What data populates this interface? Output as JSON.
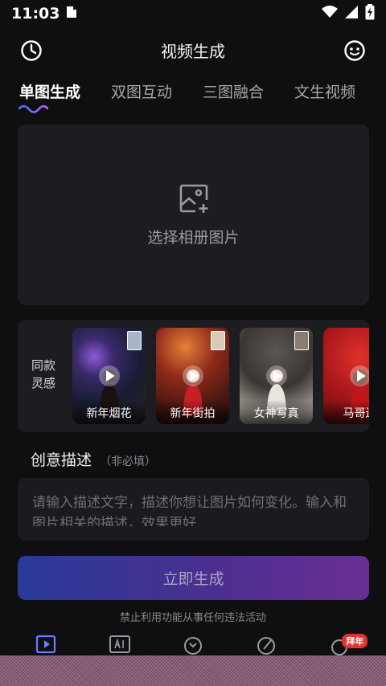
{
  "status_bar": {
    "time": "11:03"
  },
  "header": {
    "title": "视频生成",
    "history_icon": "clock-icon",
    "feedback_icon": "smiley-icon"
  },
  "tabs": [
    {
      "label": "单图生成",
      "active": true
    },
    {
      "label": "双图互动",
      "active": false
    },
    {
      "label": "三图融合",
      "active": false
    },
    {
      "label": "文生视频",
      "active": false
    }
  ],
  "upload": {
    "label": "选择相册图片",
    "icon": "image-add-icon"
  },
  "inspiration": {
    "label": "同款\n灵感",
    "items": [
      {
        "caption": "新年烟花"
      },
      {
        "caption": "新年街拍"
      },
      {
        "caption": "女神写真"
      },
      {
        "caption": "马哥送"
      }
    ]
  },
  "description": {
    "title": "创意描述",
    "subtitle": "（非必填）",
    "placeholder": "请输入描述文字，描述你想让图片如何变化。输入和图片相关的描述，效果更好"
  },
  "generate_button": {
    "label": "立即生成"
  },
  "disclaimer": "禁止利用功能从事任何违法活动",
  "bottom_nav": {
    "items": [
      {
        "icon": "video-ai-icon"
      },
      {
        "icon": "ai-image-icon"
      },
      {
        "icon": "compass-icon"
      },
      {
        "icon": "brush-icon"
      },
      {
        "icon": "profile-icon",
        "badge": "拜年"
      }
    ]
  },
  "colors": {
    "background": "#0f0f11",
    "card": "#1d1d21",
    "accent_start": "#2a3a9a",
    "accent_end": "#6a2e92",
    "badge": "#e5322a"
  }
}
